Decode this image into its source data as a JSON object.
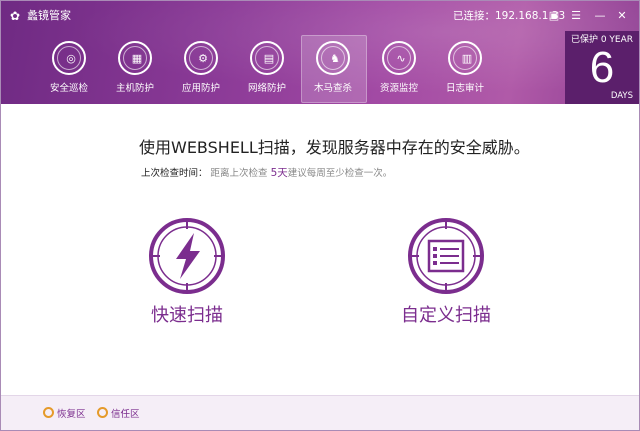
{
  "app": {
    "title": "蠡镜管家",
    "logo_glyph": "✿"
  },
  "connection": {
    "text": "已连接：192.168.1.33"
  },
  "controls": [
    {
      "name": "feedback-icon",
      "glyph": "▣"
    },
    {
      "name": "menu-icon",
      "glyph": "☰"
    },
    {
      "name": "minimize-icon",
      "glyph": "—"
    },
    {
      "name": "close-icon",
      "glyph": "✕"
    }
  ],
  "nav": [
    {
      "label": "安全巡检",
      "icon": "radar-icon",
      "glyph": "◎",
      "active": false
    },
    {
      "label": "主机防护",
      "icon": "shield-icon",
      "glyph": "▦",
      "active": false
    },
    {
      "label": "应用防护",
      "icon": "app-shield-icon",
      "glyph": "⚙",
      "active": false
    },
    {
      "label": "网络防护",
      "icon": "network-shield-icon",
      "glyph": "▤",
      "active": false
    },
    {
      "label": "木马查杀",
      "icon": "trojan-horse-icon",
      "glyph": "♞",
      "active": true
    },
    {
      "label": "资源监控",
      "icon": "monitor-icon",
      "glyph": "∿",
      "active": false
    },
    {
      "label": "日志审计",
      "icon": "log-icon",
      "glyph": "▥",
      "active": false
    }
  ],
  "protection": {
    "label": "已保护",
    "years": "0 YEAR",
    "days": "6",
    "unit": "DAYS"
  },
  "main": {
    "headline": "使用WEBSHELL扫描，发现服务器中存在的安全威胁。",
    "last_check_label": "上次检查时间：",
    "last_check_hint_prefix": "距离上次检查",
    "last_check_days": "5天",
    "last_check_hint_suffix": "建议每周至少检查一次。",
    "quick_scan_label": "快速扫描",
    "custom_scan_label": "自定义扫描"
  },
  "footer": {
    "restore_label": "恢复区",
    "trust_label": "信任区"
  },
  "colors": {
    "accent": "#7b2d8e",
    "header_start": "#6f2a83",
    "header_end": "#b05aa8",
    "footer_icon": "#e59a2a"
  }
}
